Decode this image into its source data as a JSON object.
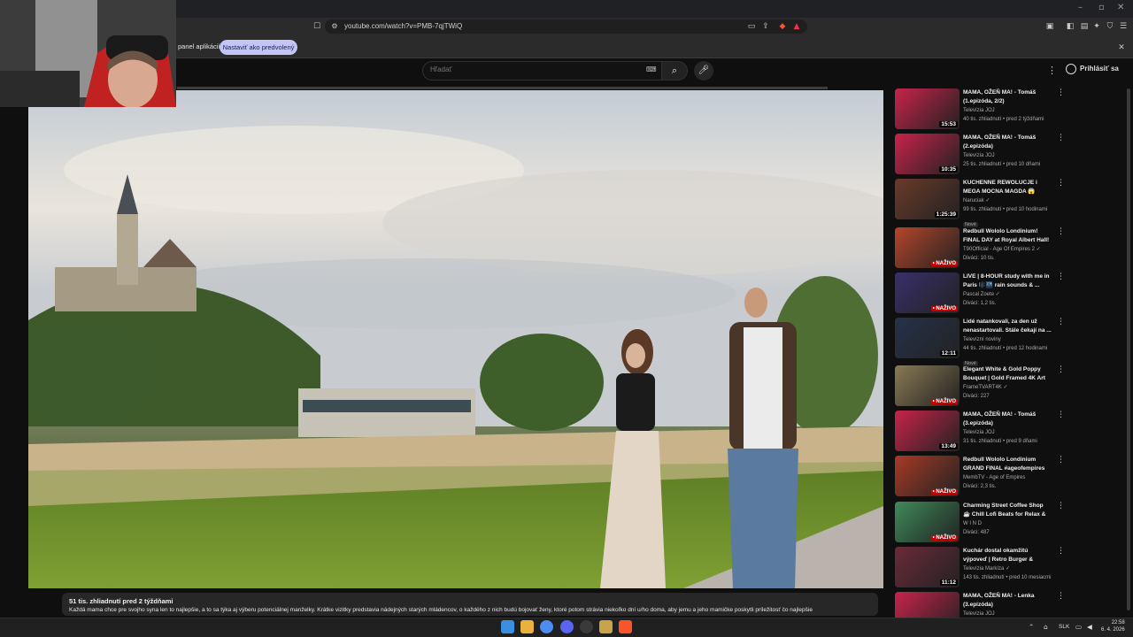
{
  "browser": {
    "url": "youtube.com/watch?v=PMB-7qjTWiQ",
    "bar_text": "panel aplikácií",
    "default_button": "Nastaviť ako predvolený"
  },
  "youtube": {
    "search_placeholder": "Hľadať",
    "signin": "Prihlásiť sa"
  },
  "video": {
    "stats": "51 tis. zhliadnutí  pred 2 týždňami",
    "description": "Každá mama chce pre svojho syna len to najlepšie, a to sa týka aj výberu potenciálnej manželky. Krátke vizitky predstavia nádejných starých mládencov, o každého z nich budú bojovať ženy, ktoré potom strávia niekoľko dní u/ho doma, aby jemu a jeho mamičke poskytli príležitosť čo najlepšie"
  },
  "recommendations": [
    {
      "title": "MAMA, OŽEŇ MA! - Tomáš (1.epizóda, 2/2)",
      "channel": "Televízia JOJ",
      "meta": "40 tis. zhliadnutí • pred 2 týždňami",
      "duration": "15:53",
      "live": "",
      "badge": "",
      "color": "#c8234a"
    },
    {
      "title": "MAMA, OŽEŇ MA! - Tomáš (2.epizóda)",
      "channel": "Televízia JOJ",
      "meta": "25 tis. zhliadnutí • pred 10 dňami",
      "duration": "10:35",
      "live": "",
      "badge": "",
      "color": "#c8234a"
    },
    {
      "title": "KUCHENNE REWOLUCJE i MEGA MOCNA MAGDA 😱",
      "channel": "Naruciak ✓",
      "meta": "99 tis. zhliadnutí • pred 10 hodinami",
      "duration": "1:25:39",
      "live": "",
      "badge": "Nové",
      "color": "#6b3a2a"
    },
    {
      "title": "Redbull Wololo Londinium! FINAL DAY at Royal Albert Hall!",
      "channel": "T90Official - Age Of Empires 2 ✓",
      "meta": "Diváci: 10 tis.",
      "duration": "",
      "live": "• NAŽIVO",
      "badge": "",
      "color": "#b5452a"
    },
    {
      "title": "LIVE | 8-HOUR study with me in Paris 🎼🌃 rain sounds & ...",
      "channel": "Pascal Zoete ✓",
      "meta": "Diváci: 1,2 tis.",
      "duration": "",
      "live": "• NAŽIVO",
      "badge": "",
      "color": "#3a2f6b"
    },
    {
      "title": "Lidé natankovali, za den už nenastartovali. Stále čekají na ...",
      "channel": "Televízní noviny",
      "meta": "44 tis. zhliadnutí • pred 12 hodinami",
      "duration": "12:11",
      "live": "",
      "badge": "Nové",
      "color": "#25324a"
    },
    {
      "title": "Elegant White & Gold Poppy Bouquet | Gold Framed 4K Art ...",
      "channel": "FrameTVART4K ✓",
      "meta": "Diváci: 227",
      "duration": "",
      "live": "• NAŽIVO",
      "badge": "",
      "color": "#8a7a55"
    },
    {
      "title": "MAMA, OŽEŇ MA! - Tomáš (3.epizóda)",
      "channel": "Televízia JOJ",
      "meta": "31 tis. zhliadnutí • pred 9 dňami",
      "duration": "13:49",
      "live": "",
      "badge": "",
      "color": "#c8234a"
    },
    {
      "title": "Redbull Wololo Londinium GRAND FINAL #ageofempires",
      "channel": "MembTV - Age of Empires",
      "meta": "Diváci: 2,3 tis.",
      "duration": "",
      "live": "• NAŽIVO",
      "badge": "",
      "color": "#a83a26"
    },
    {
      "title": "Charming Street Coffee Shop ☕ Chill Lofi Beats for Relax & ...",
      "channel": "W I N D",
      "meta": "Diváci: 487",
      "duration": "",
      "live": "• NAŽIVO",
      "badge": "",
      "color": "#3f8a5a"
    },
    {
      "title": "Kuchár dostal okamžitú výpoveď | Retro Burger & Dinn...",
      "channel": "Televízia Markíza ✓",
      "meta": "143 tis. zhliadnutí • pred 10 mesiacmi",
      "duration": "11:12",
      "live": "",
      "badge": "",
      "color": "#6b2a3a"
    },
    {
      "title": "MAMA, OŽEŇ MA! - Lenka (3.epizóda)",
      "channel": "Televízia JOJ",
      "meta": "",
      "duration": "",
      "live": "",
      "badge": "",
      "color": "#c8234a"
    }
  ],
  "taskbar": {
    "lang": "SLK",
    "time": "22:58",
    "date": "6. 4. 2026"
  }
}
